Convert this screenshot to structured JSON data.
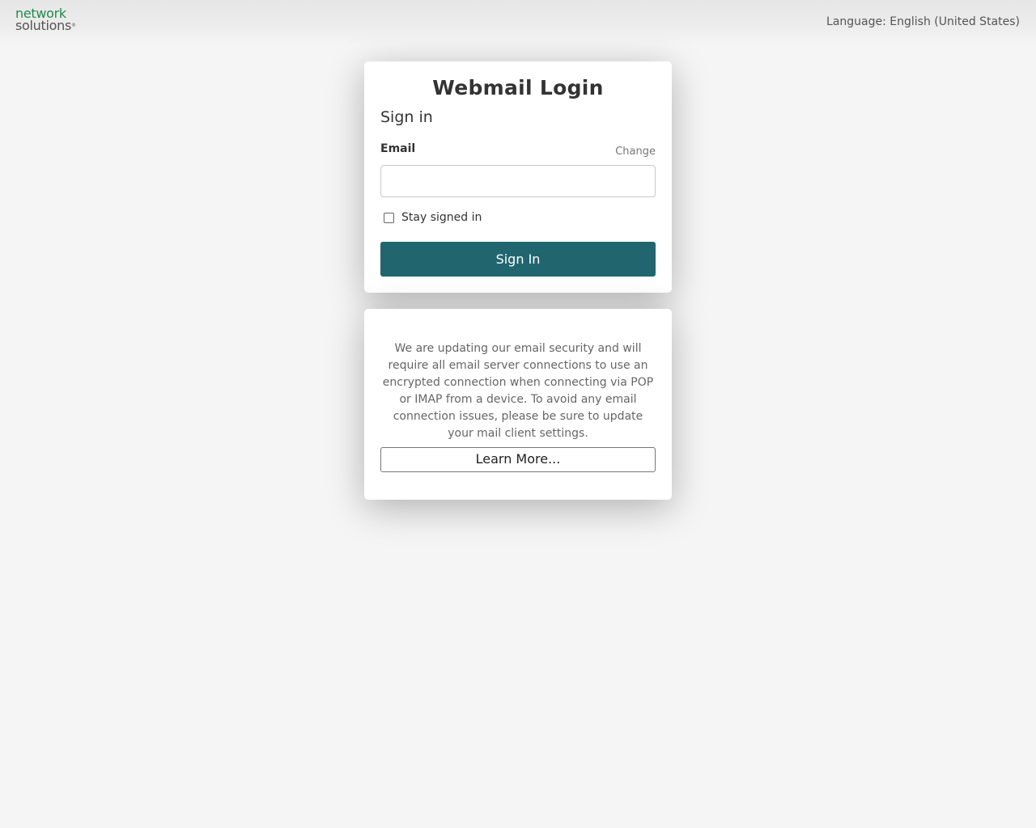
{
  "header": {
    "logo_line1": "network",
    "logo_line2": "solutions",
    "logo_mark": "®",
    "language_label": "Language: English (United States)"
  },
  "login": {
    "title": "Webmail Login",
    "heading": "Sign in",
    "email_label": "Email",
    "change_link": "Change",
    "email_value": "",
    "stay_signed_in_label": "Stay signed in",
    "stay_signed_in_checked": false,
    "signin_button": "Sign In"
  },
  "notice": {
    "message": "We are updating our email security and will require all email server connections to use an encrypted connection when connecting via POP or IMAP from a device. To avoid any email connection issues, please be sure to update your mail client settings.",
    "learn_more_button": "Learn More..."
  },
  "colors": {
    "primary_button": "#21666f",
    "logo_green": "#1f8a4c",
    "background": "#f5f5f5"
  }
}
